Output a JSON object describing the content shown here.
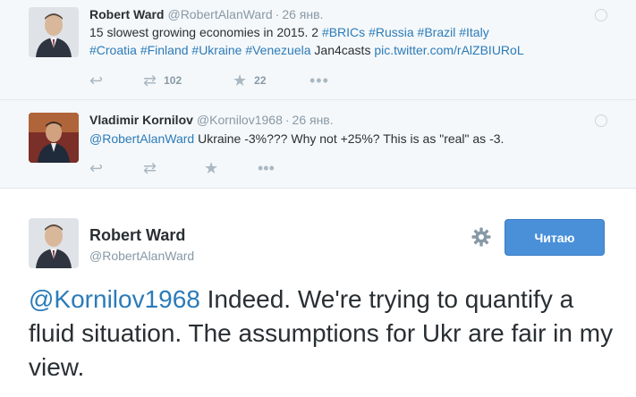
{
  "tweet1": {
    "name": "Robert Ward",
    "handle": "@RobertAlanWard",
    "dot": "·",
    "time": "26 янв.",
    "text_prefix": "15 slowest growing economies in 2015. 2 ",
    "hashtags_line1": [
      "#BRICs",
      "#Russia",
      "#Brazil",
      "#Italy"
    ],
    "hashtags_line2": [
      "#Croatia",
      "#Finland",
      "#Ukraine",
      "#Venezuela"
    ],
    "text_mid": "Jan4casts",
    "pic_link": "pic.twitter.com/rAlZBIURoL",
    "retweets": "102",
    "favorites": "22"
  },
  "tweet2": {
    "name": "Vladimir Kornilov",
    "handle": "@Kornilov1968",
    "dot": "·",
    "time": "26 янв.",
    "mention": "@RobertAlanWard",
    "text": " Ukraine -3%??? Why not +25%? This is as \"real\" as -3."
  },
  "main_tweet": {
    "name": "Robert Ward",
    "handle": "@RobertAlanWard",
    "follow_label": "Читаю",
    "mention": "@Kornilov1968",
    "text": " Indeed. We're trying to quantify a fluid situation. The assumptions for Ukr are fair in my view."
  },
  "icons": {
    "reply": "reply-icon",
    "retweet": "retweet-icon",
    "favorite": "star-icon",
    "more": "more-icon",
    "globe": "globe-icon",
    "gear": "gear-icon"
  },
  "colors": {
    "link": "#2b7bb9",
    "follow_button": "#4a90d9",
    "context_bg": "#f5f8fa"
  }
}
